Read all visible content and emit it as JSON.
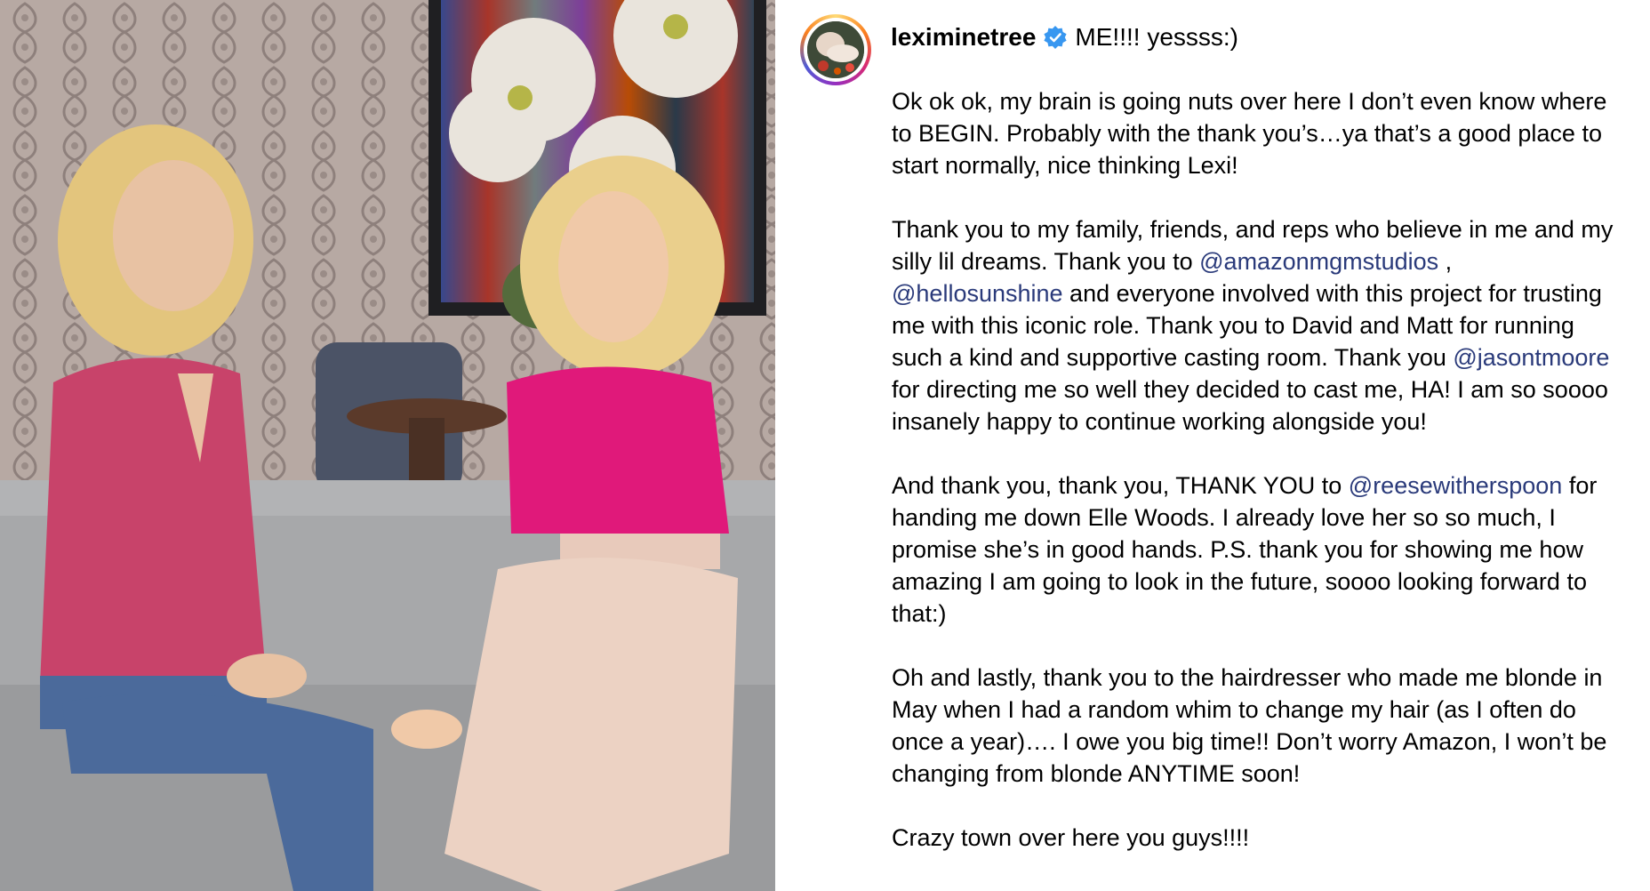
{
  "post": {
    "username": "leximinetree",
    "header_text": "ME!!!! yessss:)",
    "verified_icon": "verified-badge-icon",
    "avatar_icon": "profile-avatar",
    "media": "photo-two-women-on-couch",
    "colors": {
      "mention": "#2a3a7a",
      "verified": "#3897f0",
      "text": "#000000"
    },
    "caption": {
      "p1": "Ok ok ok, my brain is going nuts over here I don’t even know where to BEGIN. Probably with the thank you’s…ya that’s a good place to start normally, nice thinking Lexi!",
      "p2": {
        "t1": "Thank you to my family, friends, and reps who believe in me and my silly lil dreams. Thank you to ",
        "m1": "@amazonmgmstudios",
        "t2": " , ",
        "m2": "@hellosunshine",
        "t3": " and everyone involved with this project for trusting me with this iconic role. Thank you to David and Matt for running such a kind and supportive casting room. Thank you ",
        "m3": "@jasontmoore",
        "t4": " for directing me so well they decided to cast me, HA! I am so soooo insanely happy to continue working alongside you!"
      },
      "p3": {
        "t1": "And thank you, thank you, THANK YOU to ",
        "m1": "@reesewitherspoon",
        "t2": " for handing me down Elle Woods. I already love her so so much, I promise she’s in good hands. P.S. thank you for showing me how amazing I am going to look in the future, soooo looking forward to that:)"
      },
      "p4": "Oh and lastly, thank you to the hairdresser who made me blonde in May when I had a random whim to change my hair (as I often do once a year)…. I owe you big time!! Don’t worry Amazon, I won’t be changing from blonde ANYTIME soon!",
      "p5": "Crazy town over here you guys!!!!"
    }
  }
}
